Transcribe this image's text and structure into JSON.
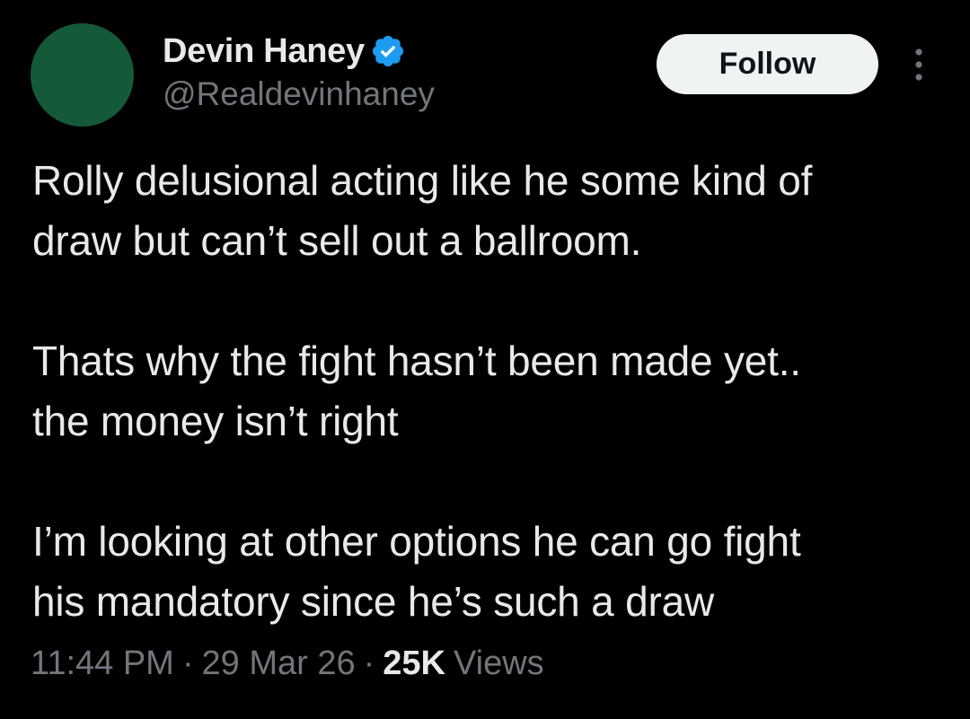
{
  "author": {
    "display_name": "Devin Haney",
    "handle": "@Realdevinhaney",
    "avatar_color": "#145a38",
    "verified": true,
    "verified_icon": "verified-badge-icon",
    "verified_color": "#1d9bf0"
  },
  "actions": {
    "follow_label": "Follow",
    "more_icon": "more-vertical-icon"
  },
  "tweet": {
    "lines": [
      "Rolly delusional acting like he some kind of",
      "draw but can’t sell out a ballroom.",
      "",
      "Thats why the fight hasn’t been made yet..",
      "the money isn’t right",
      "",
      "I’m looking at other options he can go fight",
      "his mandatory since he’s such a draw"
    ]
  },
  "meta": {
    "time": "11:44 PM",
    "date": "29 Mar 26",
    "separator": "·",
    "views_count": "25K",
    "views_label": "Views"
  },
  "colors": {
    "background": "#000000",
    "primary_text": "#e7e9ea",
    "secondary_text": "#71767b",
    "follow_bg": "#eff3f4",
    "follow_text": "#0f1419"
  }
}
